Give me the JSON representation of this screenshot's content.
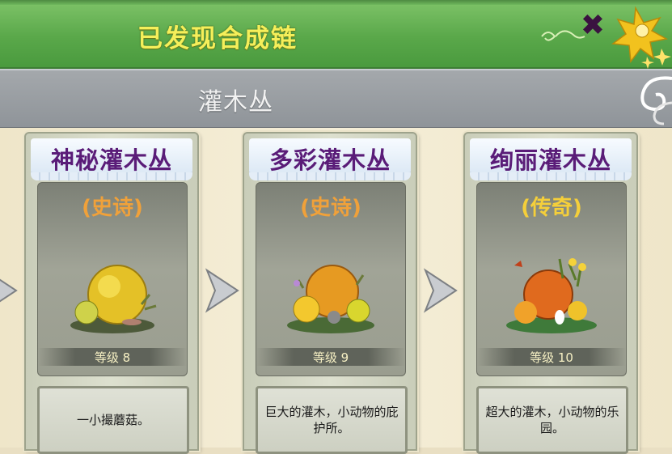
{
  "header": {
    "title": "已发现合成链",
    "close_icon": "close-x-icon"
  },
  "subheader": {
    "subtitle": "灌木丛"
  },
  "cards": [
    {
      "name": "神秘灌木丛",
      "rarity": "(史诗)",
      "rarity_color": "#f0a13a",
      "level": "等级 8",
      "description": "一小撮蘑菇。",
      "icon": "mystery-bush-icon"
    },
    {
      "name": "多彩灌木丛",
      "rarity": "(史诗)",
      "rarity_color": "#f0a13a",
      "level": "等级 9",
      "description": "巨大的灌木，小动物的庇护所。",
      "icon": "colorful-bush-icon"
    },
    {
      "name": "绚丽灌木丛",
      "rarity": "(传奇)",
      "rarity_color": "#f5cf3a",
      "level": "等级 10",
      "description": "超大的灌木，小动物的乐园。",
      "icon": "gorgeous-bush-icon"
    }
  ],
  "arrows": [
    "arrow-right-icon",
    "arrow-right-icon",
    "arrow-right-icon"
  ]
}
